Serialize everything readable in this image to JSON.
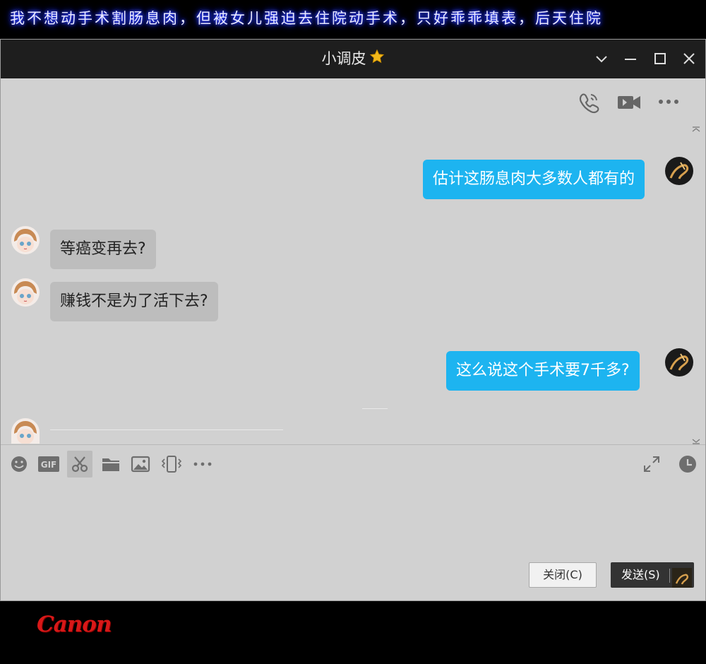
{
  "caption": "我不想动手术割肠息肉，但被女儿强迫去住院动手术，只好乖乖填表，后天住院",
  "window": {
    "title": "小调皮"
  },
  "icons": {
    "title_badge": "star-icon",
    "chevron": "chevron-down-icon",
    "minimize": "minimize-icon",
    "maximize": "maximize-icon",
    "close": "close-icon",
    "voice_call": "phone-icon",
    "video_call": "video-camera-icon",
    "more": "more-dots-icon"
  },
  "messages": [
    {
      "side": "out",
      "text": "估计这肠息肉大多数人都有的"
    },
    {
      "side": "in",
      "text": "等癌变再去?"
    },
    {
      "side": "in",
      "text": "赚钱不是为了活下去?"
    },
    {
      "side": "out",
      "text": "这么说这个手术要7千多?"
    }
  ],
  "input_toolbar": [
    "emoji-icon",
    "gif-icon",
    "scissors-icon",
    "folder-icon",
    "image-icon",
    "shake-icon",
    "more-dots-icon",
    "expand-icon",
    "history-clock-icon"
  ],
  "buttons": {
    "close": "关闭(C)",
    "send": "发送(S)"
  },
  "brand": "Canon",
  "colors": {
    "outgoing_bubble": "#1db4f0",
    "incoming_bubble": "#bdbdbd",
    "titlebar": "#1e1e1e",
    "chat_bg": "#d1d1d1"
  }
}
